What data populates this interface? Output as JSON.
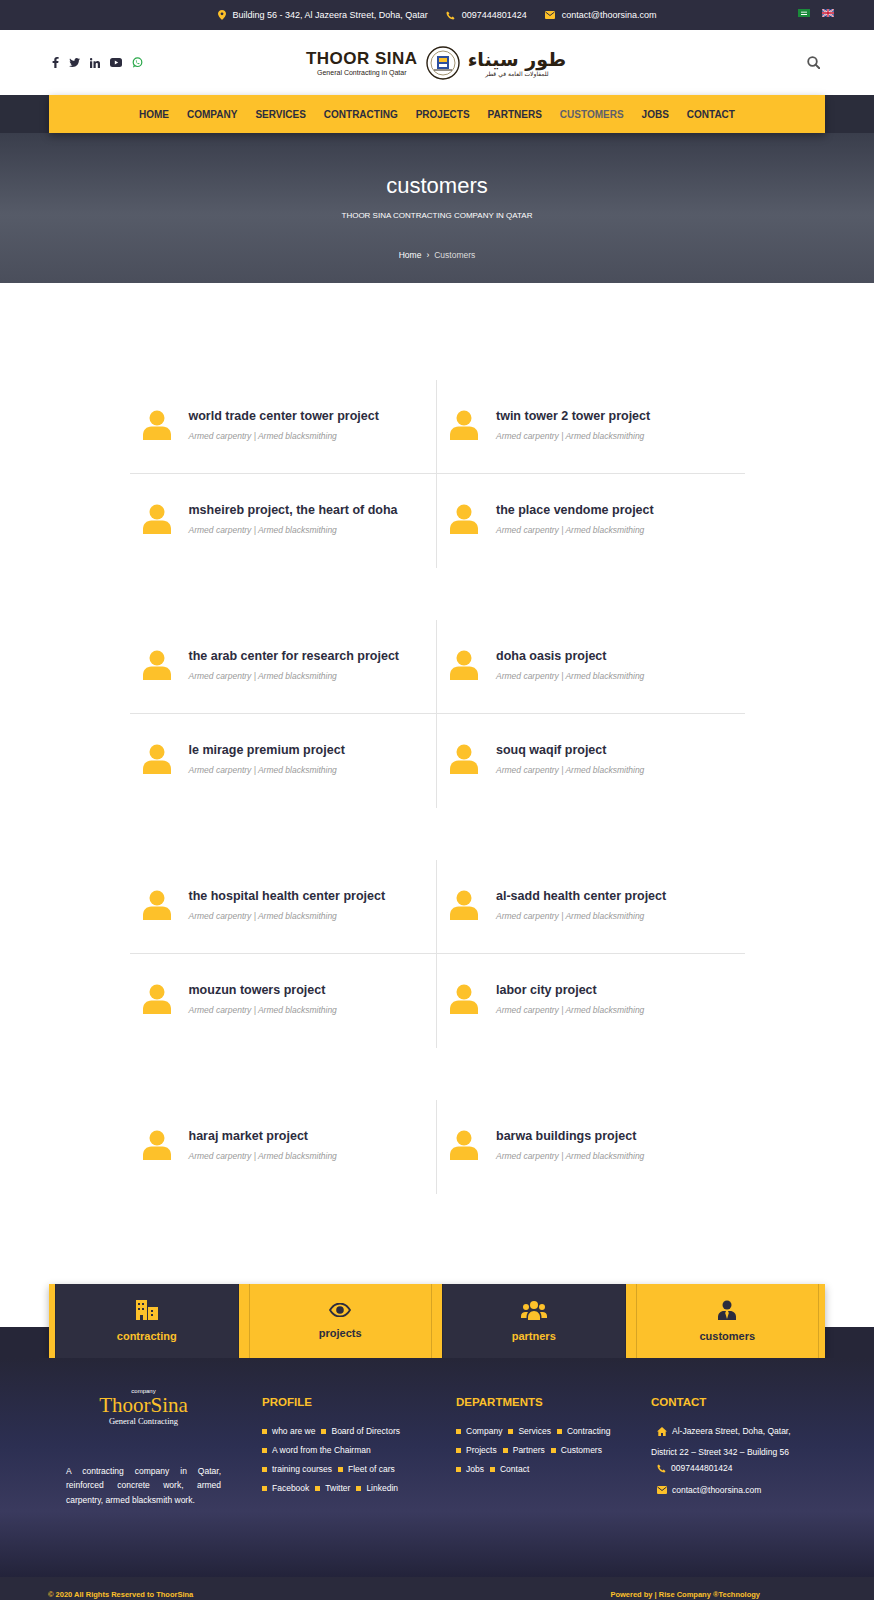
{
  "topbar": {
    "address": "Building 56 - 342, Al Jazeera Street, Doha, Qatar",
    "phone": "0097444801424",
    "email": "contact@thoorsina.com"
  },
  "logo": {
    "name": "THOOR SINA",
    "tagline": "General Contracting in Qatar",
    "arabic_name": "طور سيناء",
    "arabic_tagline": "للمقاولات العامة في قطر"
  },
  "nav": [
    {
      "label": "HOME",
      "selected": false
    },
    {
      "label": "COMPANY",
      "selected": false
    },
    {
      "label": "SERVICES",
      "selected": false
    },
    {
      "label": "CONTRACTING",
      "selected": false
    },
    {
      "label": "PROJECTS",
      "selected": false
    },
    {
      "label": "PARTNERS",
      "selected": false
    },
    {
      "label": "CUSTOMERS",
      "selected": true
    },
    {
      "label": "JOBS",
      "selected": false
    },
    {
      "label": "CONTACT",
      "selected": false
    }
  ],
  "hero": {
    "title": "customers",
    "subtitle": "THOOR SINA CONTRACTING COMPANY IN QATAR",
    "breadcrumb": {
      "home": "Home",
      "separator": "›",
      "current": "Customers"
    }
  },
  "customers": [
    {
      "title": "world trade center tower project",
      "subtitle": "Armed carpentry | Armed blacksmithing"
    },
    {
      "title": "twin tower 2 tower project",
      "subtitle": "Armed carpentry | Armed blacksmithing"
    },
    {
      "title": "msheireb project, the heart of doha",
      "subtitle": "Armed carpentry | Armed blacksmithing"
    },
    {
      "title": "the place vendome project",
      "subtitle": "Armed carpentry | Armed blacksmithing"
    },
    {
      "title": "the arab center for research project",
      "subtitle": "Armed carpentry | Armed blacksmithing"
    },
    {
      "title": "doha oasis project",
      "subtitle": "Armed carpentry | Armed blacksmithing"
    },
    {
      "title": "le mirage premium project",
      "subtitle": "Armed carpentry | Armed blacksmithing"
    },
    {
      "title": "souq waqif project",
      "subtitle": "Armed carpentry | Armed blacksmithing"
    },
    {
      "title": "the hospital health center project",
      "subtitle": "Armed carpentry | Armed blacksmithing"
    },
    {
      "title": "al-sadd health center project",
      "subtitle": "Armed carpentry | Armed blacksmithing"
    },
    {
      "title": "mouzun towers project",
      "subtitle": "Armed carpentry | Armed blacksmithing"
    },
    {
      "title": "labor city project",
      "subtitle": "Armed carpentry | Armed blacksmithing"
    },
    {
      "title": "haraj market project",
      "subtitle": "Armed carpentry | Armed blacksmithing"
    },
    {
      "title": "barwa buildings project",
      "subtitle": "Armed carpentry | Armed blacksmithing"
    }
  ],
  "tiles": [
    {
      "label": "contracting",
      "kind": "dark"
    },
    {
      "label": "projects",
      "kind": "light"
    },
    {
      "label": "partners",
      "kind": "dark"
    },
    {
      "label": "customers",
      "kind": "light"
    }
  ],
  "footer": {
    "logo": {
      "small": "company",
      "name": "ThoorSina",
      "tagline": "General Contracting"
    },
    "description": "A contracting company in Qatar, reinforced concrete work, armed carpentry, armed blacksmith work.",
    "profile": {
      "title": "PROFILE",
      "rows": [
        [
          "who are we",
          "Board of Directors"
        ],
        [
          "A word from the Chairman"
        ],
        [
          "training courses",
          "Fleet of cars"
        ],
        [
          "Facebook",
          "Twitter",
          "Linkedin"
        ]
      ]
    },
    "departments": {
      "title": "DEPARTMENTS",
      "rows": [
        [
          "Company",
          "Services",
          "Contracting"
        ],
        [
          "Projects",
          "Partners",
          "Customers"
        ],
        [
          "Jobs",
          "Contact"
        ]
      ]
    },
    "contact": {
      "title": "CONTACT",
      "address_lines": [
        "Al-Jazeera Street, Doha, Qatar,",
        "District 22 – Street 342 – Building 56"
      ],
      "phone": "0097444801424",
      "email": "contact@thoorsina.com"
    }
  },
  "bottom": {
    "copyright": "© 2020 All Rights Reserved to ThoorSina",
    "powered": "Powered by | Rise Company ®Technology"
  }
}
